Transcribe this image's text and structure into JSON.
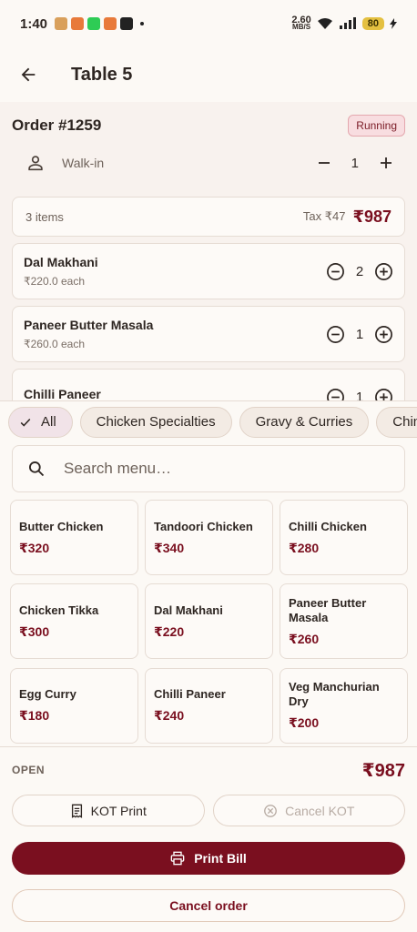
{
  "status_bar": {
    "time": "1:40",
    "net_speed_value": "2.60",
    "net_speed_unit": "MB/S",
    "battery": "80"
  },
  "app_bar": {
    "title": "Table 5"
  },
  "order": {
    "number": "Order #1259",
    "status": "Running",
    "customer": "Walk-in",
    "guests": "1",
    "summary": {
      "items": "3 items",
      "tax": "Tax ₹47",
      "total": "₹987"
    },
    "items": [
      {
        "name": "Dal Makhani",
        "each": "₹220.0 each",
        "qty": "2"
      },
      {
        "name": "Paneer Butter Masala",
        "each": "₹260.0 each",
        "qty": "1"
      },
      {
        "name": "Chilli Paneer",
        "each": "",
        "qty": "1"
      }
    ]
  },
  "categories": [
    {
      "label": "All",
      "selected": true
    },
    {
      "label": "Chicken Specialties",
      "selected": false
    },
    {
      "label": "Gravy & Curries",
      "selected": false
    },
    {
      "label": "Chine",
      "selected": false
    }
  ],
  "search": {
    "placeholder": "Search menu…"
  },
  "menu": [
    {
      "name": "Butter Chicken",
      "price": "₹320"
    },
    {
      "name": "Tandoori Chicken",
      "price": "₹340"
    },
    {
      "name": "Chilli Chicken",
      "price": "₹280"
    },
    {
      "name": "Chicken Tikka",
      "price": "₹300"
    },
    {
      "name": "Dal Makhani",
      "price": "₹220"
    },
    {
      "name": "Paneer Butter Masala",
      "price": "₹260"
    },
    {
      "name": "Egg Curry",
      "price": "₹180"
    },
    {
      "name": "Chilli Paneer",
      "price": "₹240"
    },
    {
      "name": "Veg Manchurian Dry",
      "price": "₹200"
    }
  ],
  "footer": {
    "state_label": "OPEN",
    "total": "₹987",
    "kot_print": "KOT Print",
    "cancel_kot": "Cancel KOT",
    "print_bill": "Print Bill",
    "cancel_order": "Cancel order"
  },
  "colors": {
    "accent": "#7a0f1f",
    "background": "#fcf9f5",
    "status_badge_bg": "#f8dde0"
  }
}
